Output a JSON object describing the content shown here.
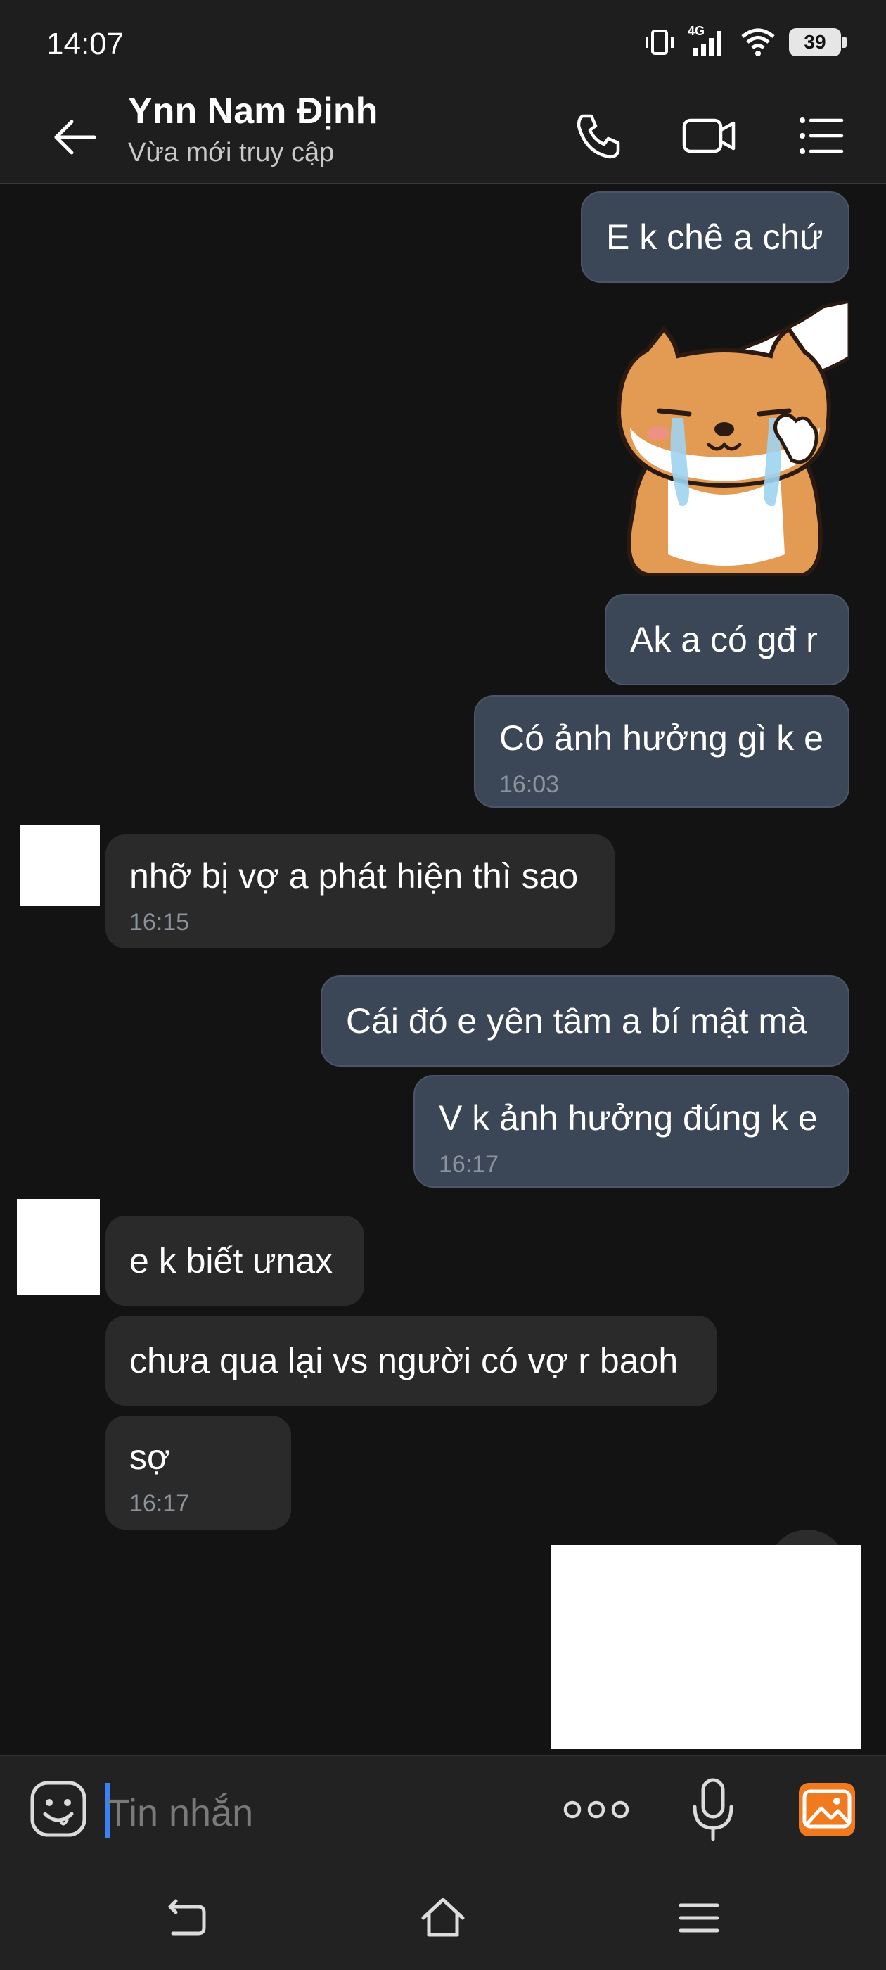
{
  "status_bar": {
    "time": "14:07",
    "network": "4G",
    "battery": "39"
  },
  "header": {
    "contact_name": "Ynn Nam Định",
    "status": "Vừa mới truy cập"
  },
  "messages": [
    {
      "dir": "out",
      "text": "E k chê a chứ"
    },
    {
      "dir": "out",
      "type": "sticker",
      "sticker": "crying-shiba-sticker"
    },
    {
      "dir": "out",
      "text": "Ak a có gđ r"
    },
    {
      "dir": "out",
      "text": "Có ảnh hưởng gì k e",
      "time": "16:03"
    },
    {
      "dir": "in",
      "text": "nhỡ bị vợ a phát hiện thì sao",
      "time": "16:15"
    },
    {
      "dir": "out",
      "text": "Cái đó e yên tâm a bí mật mà"
    },
    {
      "dir": "out",
      "text": "V k ảnh hưởng đúng k e",
      "time": "16:17"
    },
    {
      "dir": "in",
      "text": "e k biết ưnax"
    },
    {
      "dir": "in",
      "text": "chưa qua lại vs người có vợ r baoh"
    },
    {
      "dir": "in",
      "text": "sợ",
      "time": "16:17"
    }
  ],
  "input": {
    "placeholder": "Tin nhắn"
  },
  "colors": {
    "accent": "#3b82f6",
    "outgoing_bubble": "#3b4657",
    "incoming_bubble": "#2a2a2a",
    "gallery": "#f07a1d"
  }
}
